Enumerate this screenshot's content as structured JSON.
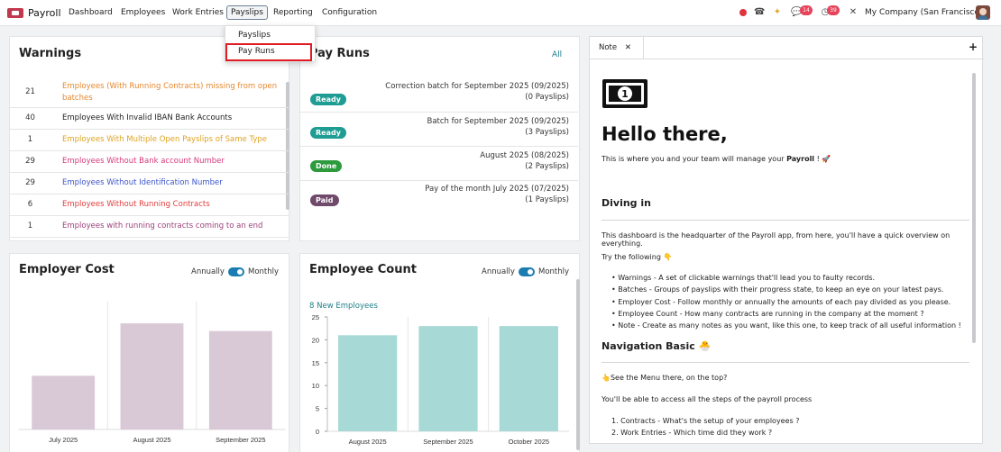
{
  "nav": {
    "app_name": "Payroll",
    "items": [
      "Dashboard",
      "Employees",
      "Work Entries",
      "Payslips",
      "Reporting",
      "Configuration"
    ],
    "company": "My Company (San Francisco)",
    "badges": {
      "chat": "14",
      "activity": "39"
    }
  },
  "dropdown": {
    "items": [
      "Payslips",
      "Pay Runs"
    ]
  },
  "warnings": {
    "title": "Warnings",
    "rows": [
      {
        "count": "21",
        "text": "Employees (With Running Contracts) missing from open batches",
        "color": "#e6882e"
      },
      {
        "count": "40",
        "text": "Employees With Invalid IBAN Bank Accounts",
        "color": "#222222"
      },
      {
        "count": "1",
        "text": "Employees With Multiple Open Payslips of Same Type",
        "color": "#e0a221"
      },
      {
        "count": "29",
        "text": "Employees Without Bank account Number",
        "color": "#d63a7a"
      },
      {
        "count": "29",
        "text": "Employees Without Identification Number",
        "color": "#3c55c9"
      },
      {
        "count": "6",
        "text": "Employees Without Running Contracts",
        "color": "#e33b3b"
      },
      {
        "count": "1",
        "text": "Employees with running contracts coming to an end",
        "color": "#9b3f7a"
      }
    ]
  },
  "payruns": {
    "title": "Pay Runs",
    "all_label": "All",
    "rows": [
      {
        "status": "Ready",
        "name": "Correction batch for September 2025 (09/2025)",
        "count": "(0 Payslips)",
        "color": "#1f9c93"
      },
      {
        "status": "Ready",
        "name": "Batch for September 2025 (09/2025)",
        "count": "(3 Payslips)",
        "color": "#1f9c93"
      },
      {
        "status": "Done",
        "name": "August 2025 (08/2025)",
        "count": "(2 Payslips)",
        "color": "#2c9b3d"
      },
      {
        "status": "Paid",
        "name": "Pay of the month July 2025 (07/2025)",
        "count": "(1 Payslips)",
        "color": "#704a6b"
      }
    ]
  },
  "employer_cost": {
    "title": "Employer Cost",
    "toggle_left": "Annually",
    "toggle_right": "Monthly"
  },
  "employee_count": {
    "title": "Employee Count",
    "toggle_left": "Annually",
    "toggle_right": "Monthly",
    "subtitle": "8 New Employees"
  },
  "chart_data": [
    {
      "type": "bar",
      "categories": [
        "July 2025",
        "August 2025",
        "September 2025"
      ],
      "values": [
        4200,
        8300,
        7700
      ],
      "ylim": [
        0,
        10000
      ],
      "color": "#d9c9d6"
    },
    {
      "type": "bar",
      "categories": [
        "August 2025",
        "September 2025",
        "October 2025"
      ],
      "values": [
        21,
        23,
        23
      ],
      "ylim": [
        0,
        25
      ],
      "yticks": [
        0,
        5,
        10,
        15,
        20,
        25
      ],
      "color": "#a7d9d6"
    }
  ],
  "note": {
    "tab_label": "Note",
    "heading": "Hello there,",
    "intro_pre": "This is where you and your team will manage your ",
    "intro_bold": "Payroll",
    "intro_post": " ! 🚀",
    "section1": "Diving in",
    "p1": "This dashboard is the headquarter of the Payroll app, from here, you'll have a quick overview on everything.",
    "p2": "Try the following 👇",
    "bullets": [
      "Warnings - A set of clickable warnings that'll lead you to faulty records.",
      "Batches - Groups of payslips with their progress state, to keep an eye on your latest pays.",
      "Employer Cost - Follow monthly or annually the amounts of each pay divided as you please.",
      "Employee Count - How many contracts are running in the company at the moment ?",
      "Note - Create as many notes as you want, like this one, to keep track of all useful information !"
    ],
    "section2": "Navigation Basic 🐣",
    "p3": "👆See the Menu there, on the top?",
    "p4": "You'll be able to access all the steps of the payroll process",
    "numbered": [
      "1. Contracts - What's the setup of your employees ?",
      "2. Work Entries - Which time did they work ?"
    ]
  }
}
